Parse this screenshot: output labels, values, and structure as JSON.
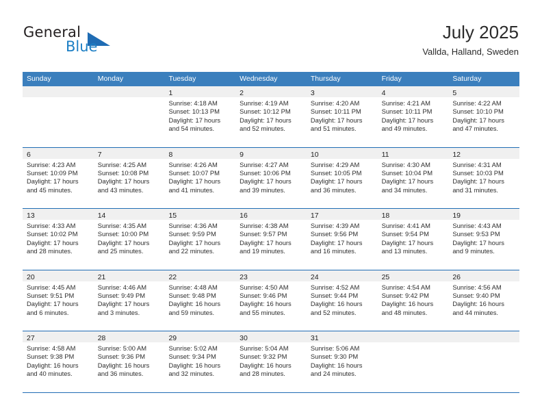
{
  "brand": {
    "name_top": "General",
    "name_bottom": "Blue",
    "accent_color": "#1b7ec4",
    "triangle_color": "#1f6cb4"
  },
  "header": {
    "title": "July 2025",
    "subtitle": "Vallda, Halland, Sweden"
  },
  "calendar": {
    "header_bg": "#3b7fbd",
    "row_divider_color": "#1f6cb4",
    "day_band_bg": "#f0f0f0",
    "weekdays": [
      "Sunday",
      "Monday",
      "Tuesday",
      "Wednesday",
      "Thursday",
      "Friday",
      "Saturday"
    ],
    "weeks": [
      [
        {
          "day": "",
          "lines": []
        },
        {
          "day": "",
          "lines": []
        },
        {
          "day": "1",
          "lines": [
            "Sunrise: 4:18 AM",
            "Sunset: 10:13 PM",
            "Daylight: 17 hours",
            "and 54 minutes."
          ]
        },
        {
          "day": "2",
          "lines": [
            "Sunrise: 4:19 AM",
            "Sunset: 10:12 PM",
            "Daylight: 17 hours",
            "and 52 minutes."
          ]
        },
        {
          "day": "3",
          "lines": [
            "Sunrise: 4:20 AM",
            "Sunset: 10:11 PM",
            "Daylight: 17 hours",
            "and 51 minutes."
          ]
        },
        {
          "day": "4",
          "lines": [
            "Sunrise: 4:21 AM",
            "Sunset: 10:11 PM",
            "Daylight: 17 hours",
            "and 49 minutes."
          ]
        },
        {
          "day": "5",
          "lines": [
            "Sunrise: 4:22 AM",
            "Sunset: 10:10 PM",
            "Daylight: 17 hours",
            "and 47 minutes."
          ]
        }
      ],
      [
        {
          "day": "6",
          "lines": [
            "Sunrise: 4:23 AM",
            "Sunset: 10:09 PM",
            "Daylight: 17 hours",
            "and 45 minutes."
          ]
        },
        {
          "day": "7",
          "lines": [
            "Sunrise: 4:25 AM",
            "Sunset: 10:08 PM",
            "Daylight: 17 hours",
            "and 43 minutes."
          ]
        },
        {
          "day": "8",
          "lines": [
            "Sunrise: 4:26 AM",
            "Sunset: 10:07 PM",
            "Daylight: 17 hours",
            "and 41 minutes."
          ]
        },
        {
          "day": "9",
          "lines": [
            "Sunrise: 4:27 AM",
            "Sunset: 10:06 PM",
            "Daylight: 17 hours",
            "and 39 minutes."
          ]
        },
        {
          "day": "10",
          "lines": [
            "Sunrise: 4:29 AM",
            "Sunset: 10:05 PM",
            "Daylight: 17 hours",
            "and 36 minutes."
          ]
        },
        {
          "day": "11",
          "lines": [
            "Sunrise: 4:30 AM",
            "Sunset: 10:04 PM",
            "Daylight: 17 hours",
            "and 34 minutes."
          ]
        },
        {
          "day": "12",
          "lines": [
            "Sunrise: 4:31 AM",
            "Sunset: 10:03 PM",
            "Daylight: 17 hours",
            "and 31 minutes."
          ]
        }
      ],
      [
        {
          "day": "13",
          "lines": [
            "Sunrise: 4:33 AM",
            "Sunset: 10:02 PM",
            "Daylight: 17 hours",
            "and 28 minutes."
          ]
        },
        {
          "day": "14",
          "lines": [
            "Sunrise: 4:35 AM",
            "Sunset: 10:00 PM",
            "Daylight: 17 hours",
            "and 25 minutes."
          ]
        },
        {
          "day": "15",
          "lines": [
            "Sunrise: 4:36 AM",
            "Sunset: 9:59 PM",
            "Daylight: 17 hours",
            "and 22 minutes."
          ]
        },
        {
          "day": "16",
          "lines": [
            "Sunrise: 4:38 AM",
            "Sunset: 9:57 PM",
            "Daylight: 17 hours",
            "and 19 minutes."
          ]
        },
        {
          "day": "17",
          "lines": [
            "Sunrise: 4:39 AM",
            "Sunset: 9:56 PM",
            "Daylight: 17 hours",
            "and 16 minutes."
          ]
        },
        {
          "day": "18",
          "lines": [
            "Sunrise: 4:41 AM",
            "Sunset: 9:54 PM",
            "Daylight: 17 hours",
            "and 13 minutes."
          ]
        },
        {
          "day": "19",
          "lines": [
            "Sunrise: 4:43 AM",
            "Sunset: 9:53 PM",
            "Daylight: 17 hours",
            "and 9 minutes."
          ]
        }
      ],
      [
        {
          "day": "20",
          "lines": [
            "Sunrise: 4:45 AM",
            "Sunset: 9:51 PM",
            "Daylight: 17 hours",
            "and 6 minutes."
          ]
        },
        {
          "day": "21",
          "lines": [
            "Sunrise: 4:46 AM",
            "Sunset: 9:49 PM",
            "Daylight: 17 hours",
            "and 3 minutes."
          ]
        },
        {
          "day": "22",
          "lines": [
            "Sunrise: 4:48 AM",
            "Sunset: 9:48 PM",
            "Daylight: 16 hours",
            "and 59 minutes."
          ]
        },
        {
          "day": "23",
          "lines": [
            "Sunrise: 4:50 AM",
            "Sunset: 9:46 PM",
            "Daylight: 16 hours",
            "and 55 minutes."
          ]
        },
        {
          "day": "24",
          "lines": [
            "Sunrise: 4:52 AM",
            "Sunset: 9:44 PM",
            "Daylight: 16 hours",
            "and 52 minutes."
          ]
        },
        {
          "day": "25",
          "lines": [
            "Sunrise: 4:54 AM",
            "Sunset: 9:42 PM",
            "Daylight: 16 hours",
            "and 48 minutes."
          ]
        },
        {
          "day": "26",
          "lines": [
            "Sunrise: 4:56 AM",
            "Sunset: 9:40 PM",
            "Daylight: 16 hours",
            "and 44 minutes."
          ]
        }
      ],
      [
        {
          "day": "27",
          "lines": [
            "Sunrise: 4:58 AM",
            "Sunset: 9:38 PM",
            "Daylight: 16 hours",
            "and 40 minutes."
          ]
        },
        {
          "day": "28",
          "lines": [
            "Sunrise: 5:00 AM",
            "Sunset: 9:36 PM",
            "Daylight: 16 hours",
            "and 36 minutes."
          ]
        },
        {
          "day": "29",
          "lines": [
            "Sunrise: 5:02 AM",
            "Sunset: 9:34 PM",
            "Daylight: 16 hours",
            "and 32 minutes."
          ]
        },
        {
          "day": "30",
          "lines": [
            "Sunrise: 5:04 AM",
            "Sunset: 9:32 PM",
            "Daylight: 16 hours",
            "and 28 minutes."
          ]
        },
        {
          "day": "31",
          "lines": [
            "Sunrise: 5:06 AM",
            "Sunset: 9:30 PM",
            "Daylight: 16 hours",
            "and 24 minutes."
          ]
        },
        {
          "day": "",
          "lines": []
        },
        {
          "day": "",
          "lines": []
        }
      ]
    ]
  }
}
